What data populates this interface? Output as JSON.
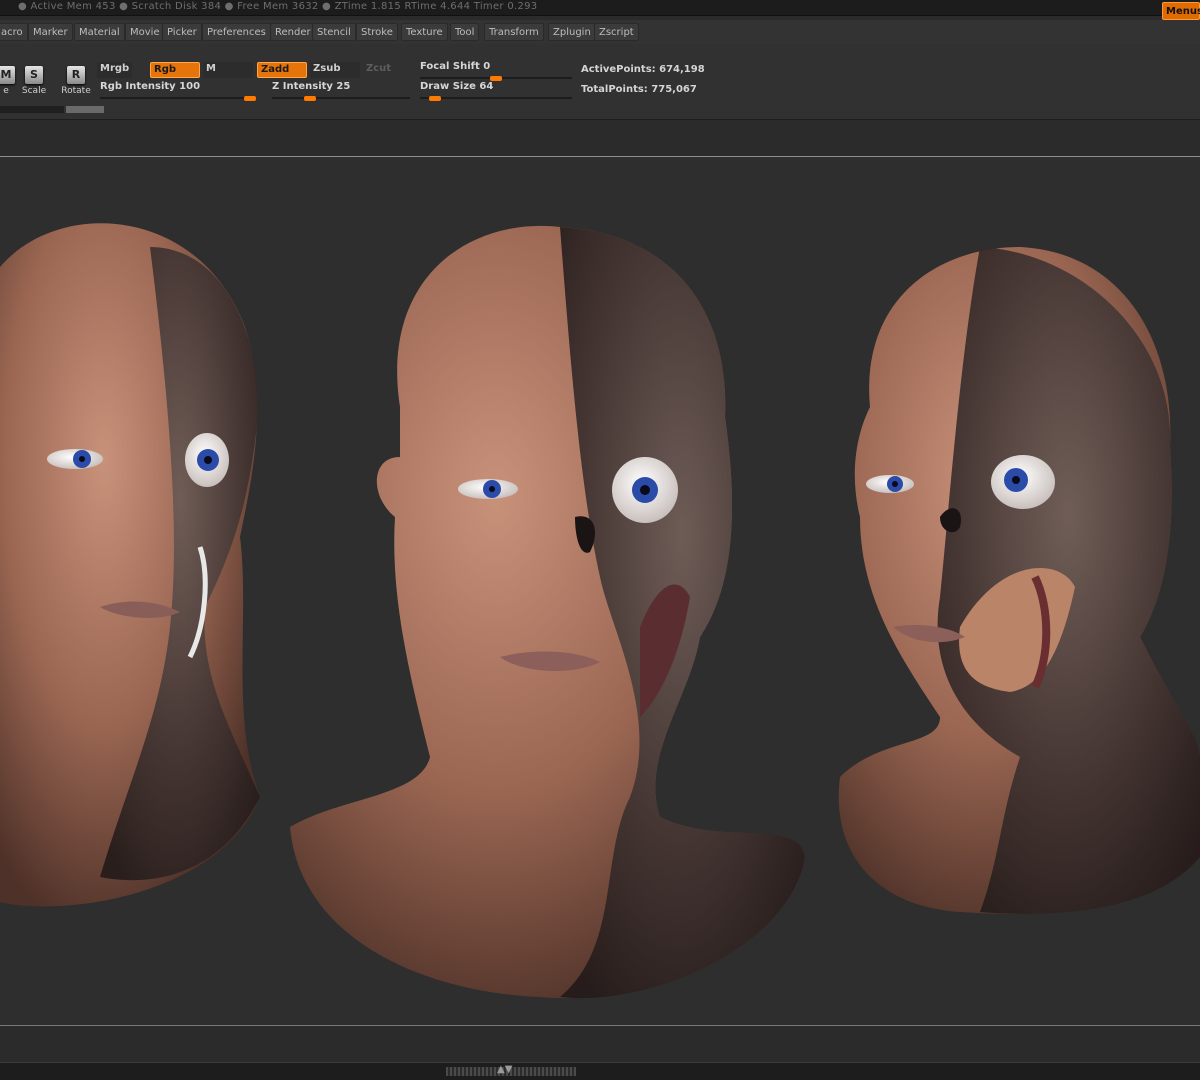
{
  "status_bar": {
    "text": "● Active Mem 453 ● Scratch Disk 384 ● Free Mem 3632 ● ZTime 1.815 RTime 4.644 Timer 0.293",
    "menus_label": "Menus"
  },
  "menu_bar": {
    "items": [
      "acro",
      "Marker",
      "Material",
      "Movie",
      "Picker",
      "Preferences",
      "Render",
      "Stencil",
      "Stroke",
      "Texture",
      "Tool",
      "Transform",
      "Zplugin",
      "Zscript"
    ]
  },
  "tools": {
    "move_label": "e",
    "move_icon_letter": "M",
    "scale_label": "Scale",
    "scale_icon_letter": "S",
    "rotate_label": "Rotate",
    "rotate_icon_letter": "R"
  },
  "modes": {
    "mrgb": "Mrgb",
    "rgb": "Rgb",
    "m": "M",
    "zadd": "Zadd",
    "zsub": "Zsub",
    "zcut": "Zcut"
  },
  "sliders": {
    "rgb_intensity": {
      "label": "Rgb Intensity 100",
      "value": 100
    },
    "z_intensity": {
      "label": "Z Intensity 25",
      "value": 25
    },
    "focal_shift": {
      "label": "Focal Shift 0",
      "value": 0
    },
    "draw_size": {
      "label": "Draw Size 64",
      "value": 64
    }
  },
  "stats": {
    "active_points": "ActivePoints: 674,198",
    "total_points": "TotalPoints: 775,067"
  },
  "colors": {
    "accent": "#e5740a",
    "canvas_bg": "#2e2e2e",
    "skin": "#b07a62",
    "decay": "#4a3b38",
    "iris": "#2b4ba8"
  }
}
